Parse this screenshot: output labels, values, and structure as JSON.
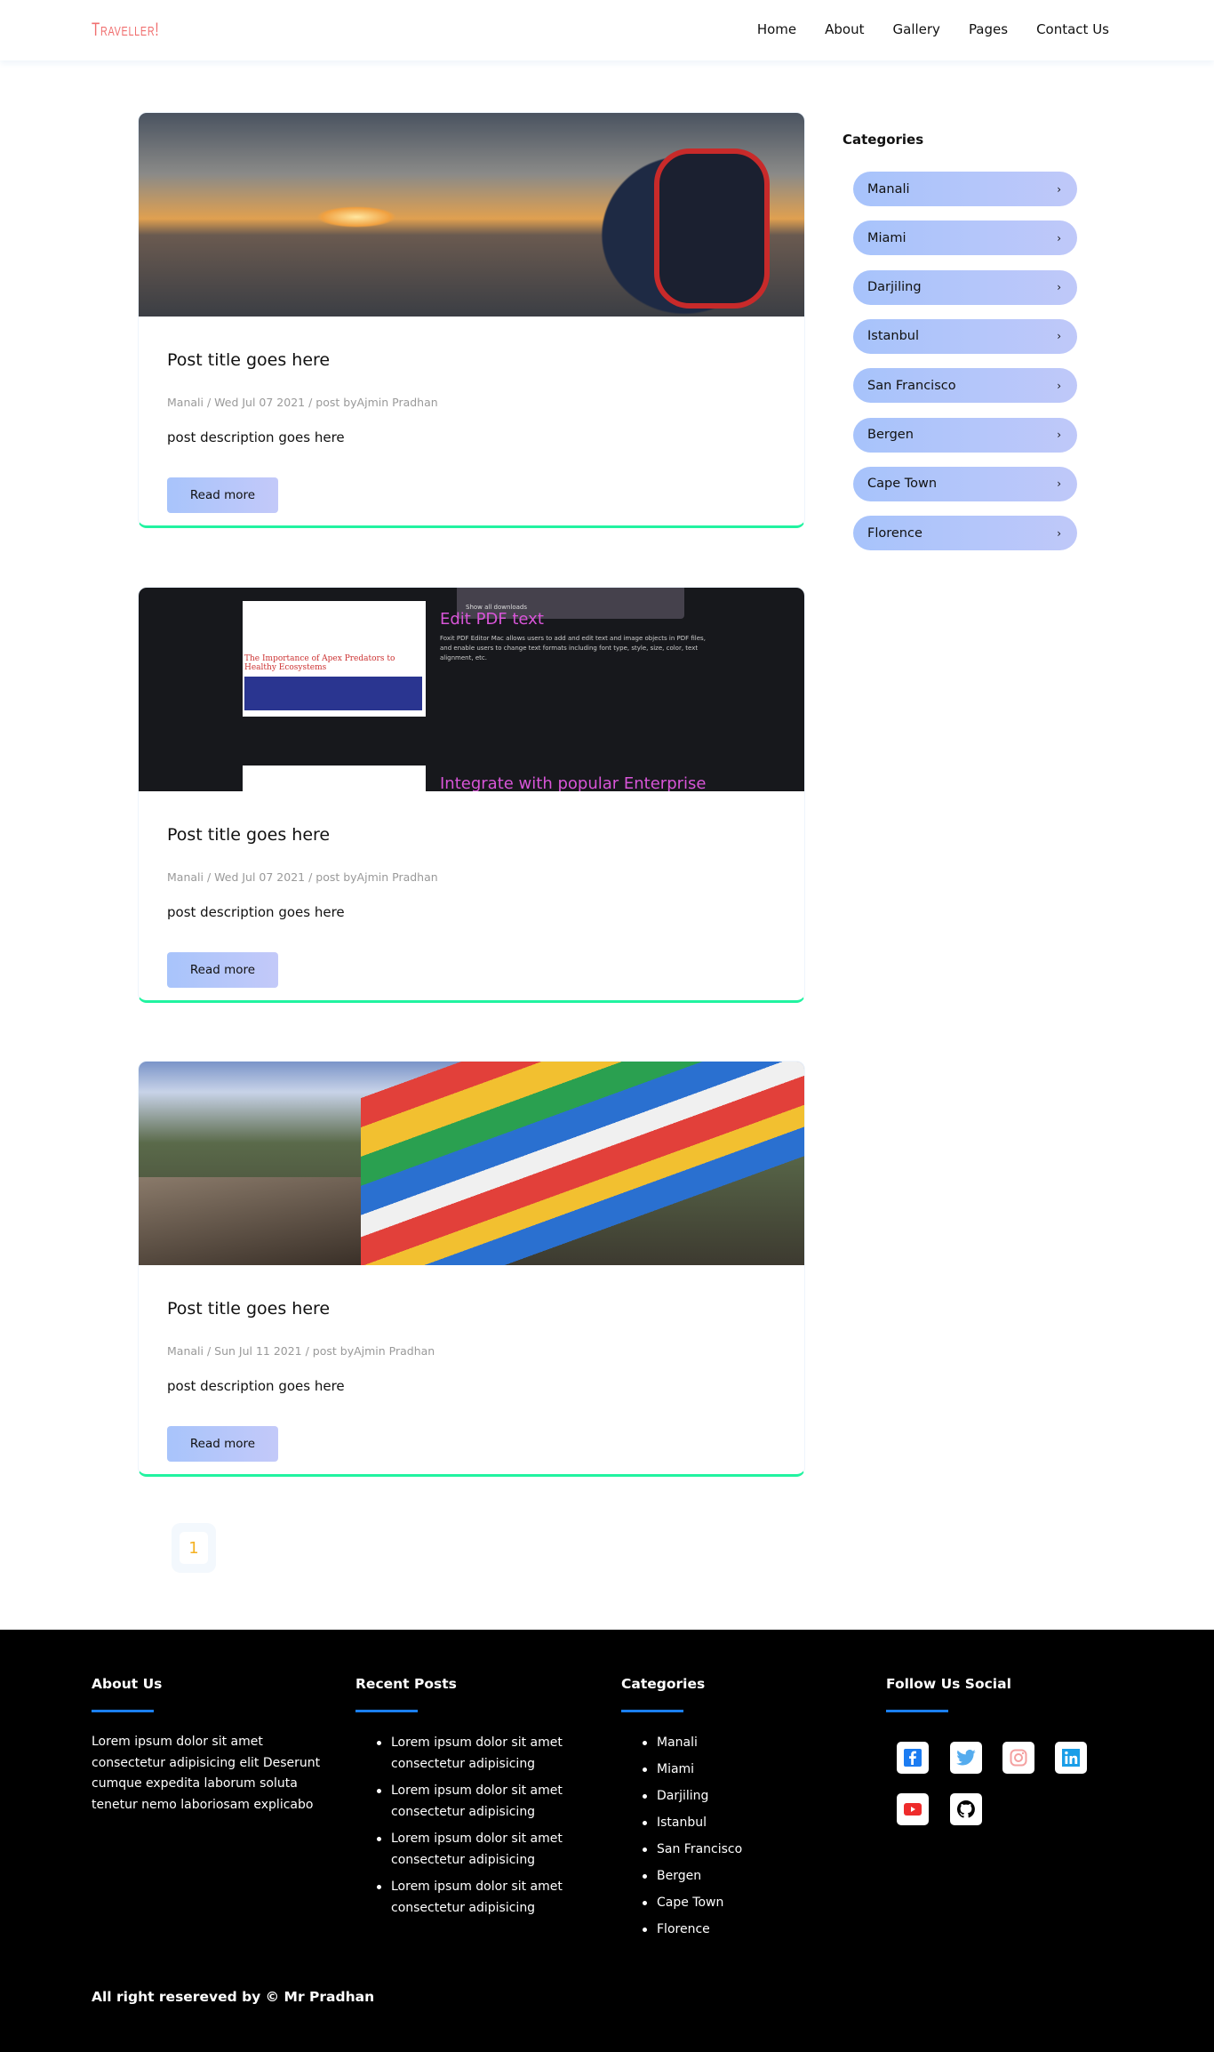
{
  "nav": {
    "logo": "Traveller!",
    "links": [
      "Home",
      "About",
      "Gallery",
      "Pages",
      "Contact Us"
    ]
  },
  "posts": [
    {
      "title": "Post title goes here",
      "meta": "Manali / Wed Jul 07 2021 / post byAjmin Pradhan",
      "description": "post description goes here",
      "button": "Read more"
    },
    {
      "title": "Post title goes here",
      "meta": "Manali / Wed Jul 07 2021 / post byAjmin Pradhan",
      "description": "post description goes here",
      "button": "Read more",
      "image_text": {
        "doc_heading": "The Importance of Apex Predators to Healthy Ecosystems",
        "popup": "Show all downloads",
        "heading1": "Edit PDF text",
        "body": "Foxit PDF Editor Mac allows users to add and edit text and image objects in PDF files, and enable users to change text formats including font type, style, size, color, text alignment, etc.",
        "heading2": "Integrate with popular Enterprise"
      }
    },
    {
      "title": "Post title goes here",
      "meta": "Manali / Sun Jul 11 2021 / post byAjmin Pradhan",
      "description": "post description goes here",
      "button": "Read more"
    }
  ],
  "pagination": {
    "current": "1"
  },
  "sidebar": {
    "heading": "Categories",
    "items": [
      "Manali",
      "Miami",
      "Darjiling",
      "Istanbul",
      "San Francisco",
      "Bergen",
      "Cape Town",
      "Florence"
    ],
    "chevron": "›"
  },
  "footer": {
    "about": {
      "heading": "About Us",
      "text": "Lorem ipsum dolor sit amet consectetur adipisicing elit Deserunt cumque expedita laborum soluta tenetur nemo laboriosam explicabo"
    },
    "recent": {
      "heading": "Recent Posts",
      "items": [
        "Lorem ipsum dolor sit amet consectetur adipisicing",
        "Lorem ipsum dolor sit amet consectetur adipisicing",
        "Lorem ipsum dolor sit amet consectetur adipisicing",
        "Lorem ipsum dolor sit amet consectetur adipisicing"
      ]
    },
    "categories": {
      "heading": "Categories",
      "items": [
        "Manali",
        "Miami",
        "Darjiling",
        "Istanbul",
        "San Francisco",
        "Bergen",
        "Cape Town",
        "Florence"
      ]
    },
    "social": {
      "heading": "Follow Us Social",
      "icons": [
        "facebook-icon",
        "twitter-icon",
        "instagram-icon",
        "linkedin-icon",
        "youtube-icon",
        "github-icon"
      ]
    },
    "copyright": "All right resereved by © Mr Pradhan"
  },
  "colors": {
    "logo": "#f07070",
    "accent_green": "#21f3a0",
    "pill": "#a7c3fb",
    "footer_line": "#1a7ff0",
    "page_number": "#f4b020"
  }
}
